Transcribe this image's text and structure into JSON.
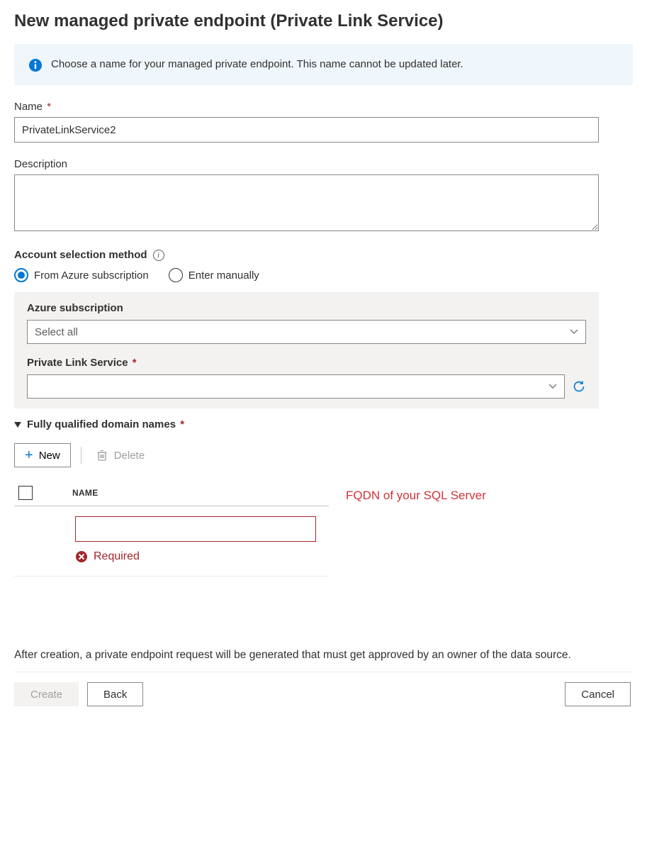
{
  "title": "New managed private endpoint (Private Link Service)",
  "info_banner": "Choose a name for your managed private endpoint. This name cannot be updated later.",
  "name": {
    "label": "Name",
    "value": "PrivateLinkService2"
  },
  "description": {
    "label": "Description",
    "value": ""
  },
  "account_method": {
    "label": "Account selection method",
    "options": {
      "from_azure": "From Azure subscription",
      "manual": "Enter manually"
    },
    "selected": "from_azure"
  },
  "azure_sub": {
    "label": "Azure subscription",
    "value": "Select all"
  },
  "pls": {
    "label": "Private Link Service",
    "value": ""
  },
  "fqdn": {
    "label": "Fully qualified domain names",
    "toolbar": {
      "new": "New",
      "delete": "Delete"
    },
    "column": "NAME",
    "row_value": "",
    "error": "Required",
    "annotation": "FQDN of your SQL Server"
  },
  "footer_note": "After creation, a private endpoint request will be generated that must get approved by an owner of the data source.",
  "buttons": {
    "create": "Create",
    "back": "Back",
    "cancel": "Cancel"
  }
}
